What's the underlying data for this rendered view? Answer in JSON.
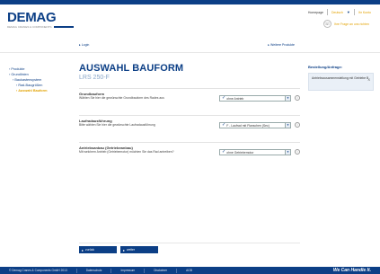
{
  "brand": {
    "logo_text": "DEMAG",
    "logo_sub": "DEMAG CRANES & COMPONENTS"
  },
  "top_links": {
    "home": "Homepage",
    "language": "Deutsch",
    "user": "Ihr Konto"
  },
  "contact": {
    "label": "Ihre Frage an uns richten"
  },
  "subnav": {
    "login": "Login",
    "more_products": "Weitere Produkte"
  },
  "leftnav": {
    "items": [
      {
        "label": "Produkte"
      },
      {
        "label": "Grundlinien"
      },
      {
        "label": "Baukastensystem"
      },
      {
        "label": "Rad-Baugrößen"
      },
      {
        "label": "Auswahl Bauform"
      }
    ]
  },
  "main": {
    "title": "AUSWAHL BAUFORM",
    "subtitle": "LRS 250-F",
    "sections": [
      {
        "title": "Grundbauform",
        "description": "Wählen Sie hier die gewünschte Grundbauform des Rades aus",
        "select_value": "ohne Antrieb"
      },
      {
        "title": "Laufradausführung",
        "description": "Bitte wählen Sie hier die gewünschte Laufradausführung",
        "select_value": "F - Laufrad mit Flanschen (Sec)"
      },
      {
        "title": "Antriebsanbau (Getriebeanbau)",
        "description": "Mit welchem Antrieb (Getriebemotor) möchten Sie das Rad antreiben?",
        "select_value": "ohne Getriebemotor"
      }
    ],
    "info_icon": "i"
  },
  "rightbox": {
    "title": "Bestellung/Anfrage:",
    "card_text": "Antriebszusammenstellung mit Getriebe B",
    "remove": "X"
  },
  "actions": {
    "back": "zurück",
    "next": "weiter"
  },
  "footer": {
    "copyright": "© Demag Cranes & Components GmbH 2013",
    "links": [
      "Datenschutz",
      "Impressum",
      "Disclaimer",
      "AGB"
    ],
    "slogan": "We Can Handle It."
  },
  "colors": {
    "brand_blue": "#0c3f86",
    "accent_orange": "#e2a200"
  }
}
